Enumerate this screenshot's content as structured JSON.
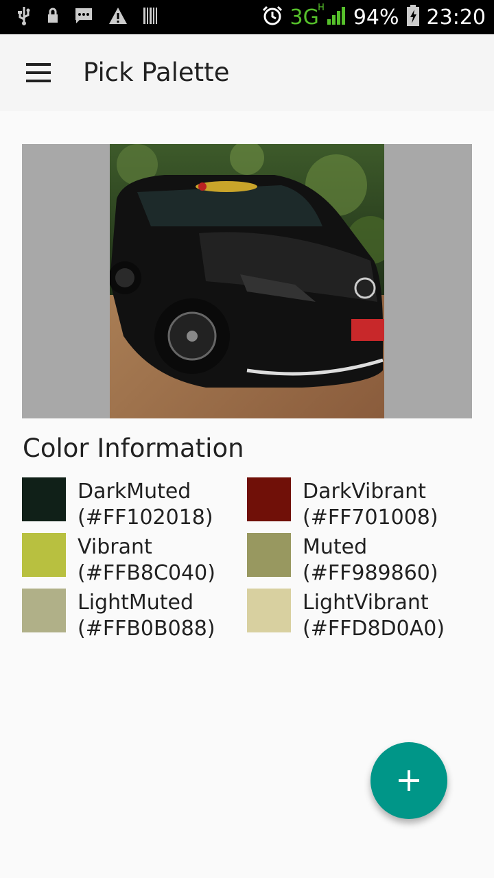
{
  "status_bar": {
    "icons_left": [
      "usb-icon",
      "lock-icon",
      "message-icon",
      "warning-icon",
      "barcode-icon"
    ],
    "icons_right": [
      "alarm-icon",
      "signal-icon",
      "battery-charging-icon"
    ],
    "network": "3G",
    "network_sub": "H",
    "battery": "94%",
    "time": "23:20"
  },
  "appbar": {
    "title": "Pick Palette",
    "menu_icon": "hamburger-menu-icon"
  },
  "section": {
    "title": "Color Information"
  },
  "swatches": [
    {
      "name": "DarkMuted",
      "hex": "(#FF102018)",
      "color": "#102018"
    },
    {
      "name": "DarkVibrant",
      "hex": "(#FF701008)",
      "color": "#701008"
    },
    {
      "name": "Vibrant",
      "hex": "(#FFB8C040)",
      "color": "#B8C040"
    },
    {
      "name": "Muted",
      "hex": "(#FF989860)",
      "color": "#989860"
    },
    {
      "name": "LightMuted",
      "hex": "(#FFB0B088)",
      "color": "#B0B088"
    },
    {
      "name": "LightVibrant",
      "hex": "(#FFD8D0A0)",
      "color": "#D8D0A0"
    }
  ],
  "fab": {
    "icon": "plus-icon"
  },
  "colors": {
    "accent": "#009688",
    "status_bar": "#000000",
    "app_bar": "#F5F5F5",
    "image_frame": "#A8A8A8"
  }
}
